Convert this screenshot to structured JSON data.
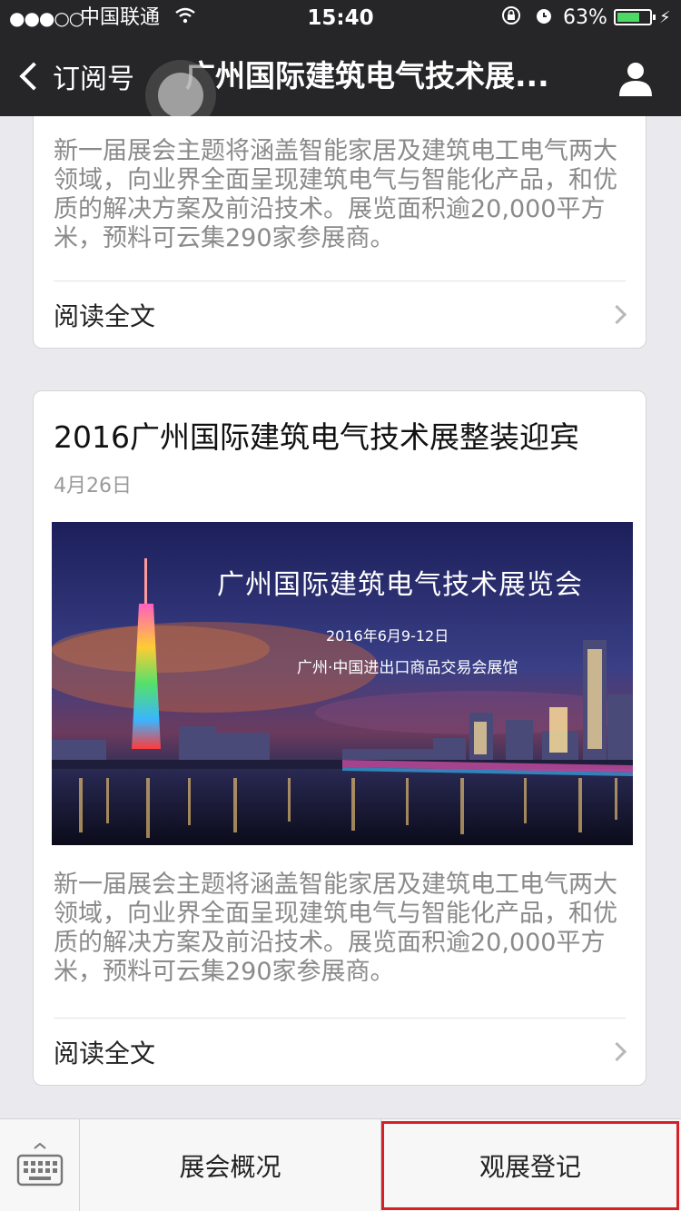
{
  "status_bar": {
    "signal": "●●●○○",
    "carrier": "中国联通",
    "time": "15:40",
    "battery_percent": "63%",
    "battery_level": 0.63
  },
  "nav": {
    "back_label": "订阅号",
    "title": "广州国际建筑电气技术展..."
  },
  "articles": [
    {
      "description": "新一届展会主题将涵盖智能家居及建筑电工电气两大领域，向业界全面呈现建筑电气与智能化产品，和优质的解决方案及前沿技术。展览面积逾20,000平方米，预料可云集290家参展商。",
      "read_more": "阅读全文"
    },
    {
      "title": "2016广州国际建筑电气技术展整装迎宾",
      "date": "4月26日",
      "banner": {
        "title": "广州国际建筑电气技术展览会",
        "date": "2016年6月9-12日",
        "venue": "广州·中国进出口商品交易会展馆"
      },
      "description": "新一届展会主题将涵盖智能家居及建筑电工电气两大领域，向业界全面呈现建筑电气与智能化产品，和优质的解决方案及前沿技术。展览面积逾20,000平方米，预料可云集290家参展商。",
      "read_more": "阅读全文"
    }
  ],
  "bottom_menu": {
    "items": [
      "展会概况",
      "观展登记"
    ]
  },
  "colors": {
    "header_bg": "#262628",
    "highlight_border": "#d62027",
    "battery": "#4cd964"
  }
}
